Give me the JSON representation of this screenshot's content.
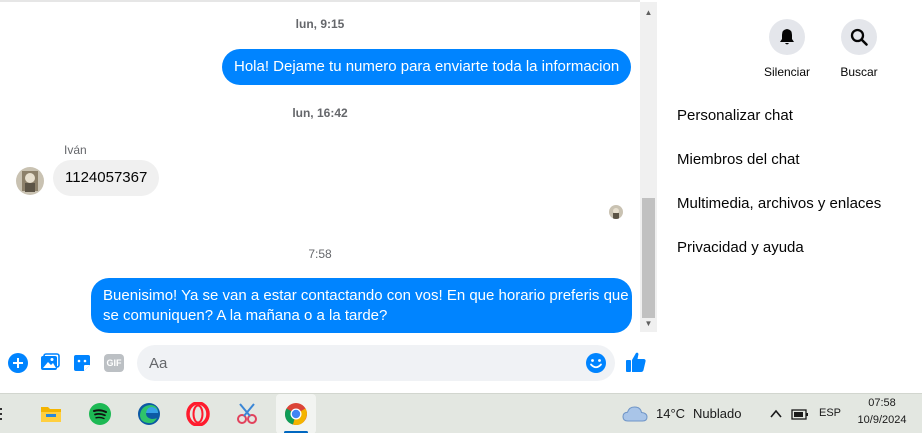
{
  "chat": {
    "ts1": "lun, 9:15",
    "msg_out_1": "Hola! Dejame tu numero para enviarte toda la informacion",
    "ts2": "lun, 16:42",
    "sender_name": "Iván",
    "msg_in_1": "1124057367",
    "ts3": "7:58",
    "msg_out_2_line1": "Buenisimo! Ya se van a estar contactando con vos! En que horario preferis que",
    "msg_out_2_line2": "se comuniquen? A la mañana o a la tarde?"
  },
  "composer": {
    "placeholder": "Aa",
    "gif_label": "GIF"
  },
  "info": {
    "actions": [
      {
        "label": "Silenciar",
        "icon": "bell-icon"
      },
      {
        "label": "Buscar",
        "icon": "search-icon"
      }
    ],
    "menu": [
      {
        "label": "Personalizar chat"
      },
      {
        "label": "Miembros del chat"
      },
      {
        "label": "Multimedia, archivos y enlaces"
      },
      {
        "label": "Privacidad y ayuda"
      }
    ]
  },
  "taskbar": {
    "weather_temp": "14°C",
    "weather_desc": "Nublado",
    "language": "ESP",
    "time": "07:58",
    "date": "10/9/2024"
  },
  "colors": {
    "accent": "#0084ff",
    "incoming_bubble": "#f0f0f0"
  }
}
